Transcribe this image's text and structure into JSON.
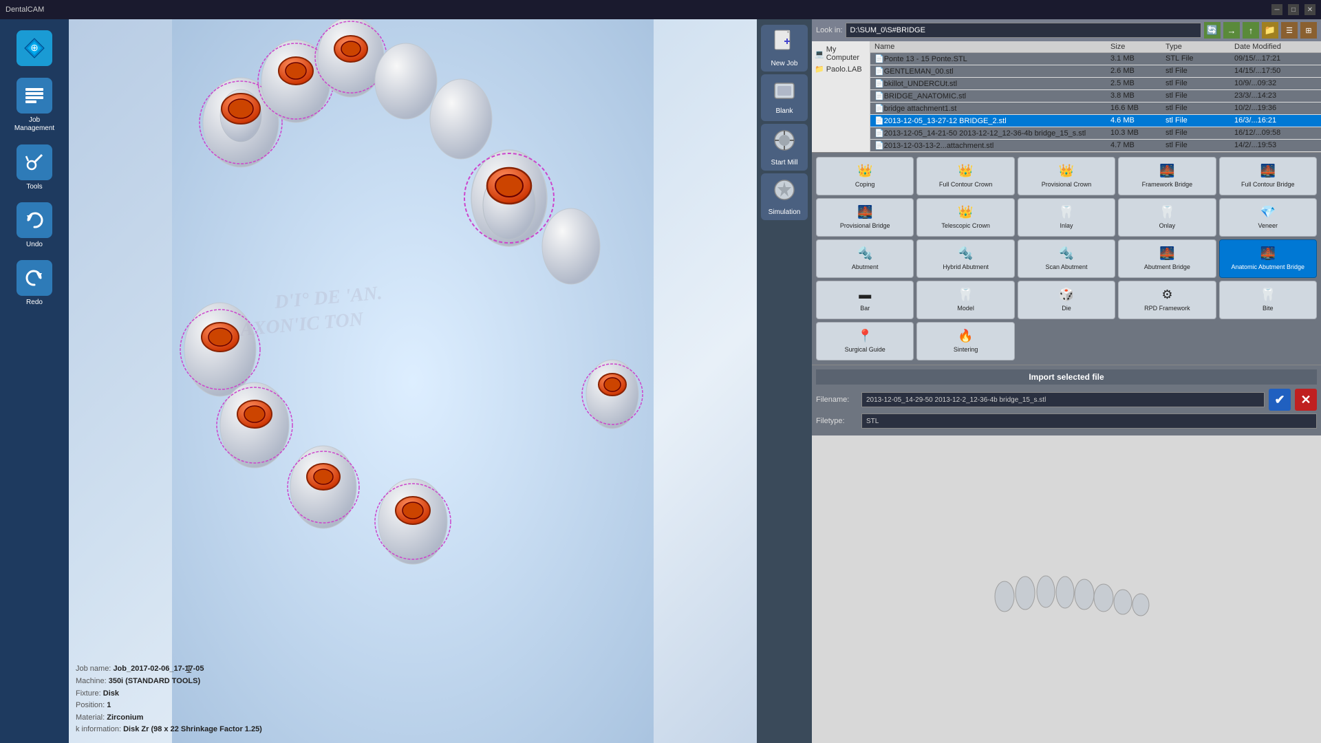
{
  "titleBar": {
    "title": "DentalCAM",
    "minimizeLabel": "─",
    "maximizeLabel": "□",
    "closeLabel": "✕"
  },
  "sidebar": {
    "items": [
      {
        "id": "navigation",
        "label": "Navigation",
        "icon": "⬡"
      },
      {
        "id": "job-management",
        "label": "Job Management",
        "icon": "⚙"
      },
      {
        "id": "tools",
        "label": "Tools",
        "icon": "🔧"
      },
      {
        "id": "undo",
        "label": "Undo",
        "icon": "↺"
      },
      {
        "id": "redo",
        "label": "Redo",
        "icon": "↻"
      }
    ]
  },
  "rightTools": {
    "items": [
      {
        "id": "new-job",
        "label": "New Job",
        "icon": "📄"
      },
      {
        "id": "blank",
        "label": "Blank",
        "icon": "⬜"
      },
      {
        "id": "start-mill",
        "label": "Start Mill",
        "icon": "⚙"
      },
      {
        "id": "simulation",
        "label": "Simulation",
        "icon": "⏱"
      }
    ]
  },
  "fileBrowser": {
    "pathLabel": "Look in:",
    "path": "D:\\SUM_0\\S#BRIDGE",
    "treeItems": [
      {
        "label": "My Computer",
        "icon": "💻"
      },
      {
        "label": "Paolo.LAB",
        "icon": "📁"
      }
    ],
    "columns": [
      "Name",
      "Size",
      "Type",
      "Date Modified"
    ],
    "files": [
      {
        "name": "Ponte 13 - 15 Ponte.STL",
        "size": "3.1 MB",
        "type": "STL File",
        "date": "09/15/...17:21",
        "selected": false
      },
      {
        "name": "GENTLEMAN_00.stl",
        "size": "2.6 MB",
        "type": "stl File",
        "date": "14/15/...17:50",
        "selected": false
      },
      {
        "name": "bkillot_UNDERCUt.stl",
        "size": "2.5 MB",
        "type": "stl File",
        "date": "10/9/...09:32",
        "selected": false
      },
      {
        "name": "BRIDGE_ANATOMIC.stl",
        "size": "3.8 MB",
        "type": "stl File",
        "date": "23/3/...14:23",
        "selected": false
      },
      {
        "name": "bridge attachment1.st",
        "size": "16.6 MB",
        "type": "stl File",
        "date": "10/2/...19:36",
        "selected": false
      },
      {
        "name": "2013-12-05_13-27-12 BRIDGE_2.stl",
        "size": "4.6 MB",
        "type": "stl File",
        "date": "16/3/...16:21",
        "selected": true
      },
      {
        "name": "2013-12-05_14-21-50 2013-12-12_12-36-4b bridge_15_s.stl",
        "size": "10.3 MB",
        "type": "stl File",
        "date": "16/12/...09:58",
        "selected": false
      },
      {
        "name": "2013-12-03-13-2...attachment.stl",
        "size": "4.7 MB",
        "type": "stl File",
        "date": "14/2/...19:53",
        "selected": false
      }
    ]
  },
  "typeGrid": {
    "rows": [
      [
        {
          "id": "coping",
          "label": "Coping",
          "icon": "👑",
          "active": false
        },
        {
          "id": "full-contour-crown",
          "label": "Full Contour Crown",
          "icon": "👑",
          "active": false
        },
        {
          "id": "provisional-crown",
          "label": "Provisional Crown",
          "icon": "👑",
          "active": false
        },
        {
          "id": "framework-bridge",
          "label": "Framework Bridge",
          "icon": "🌉",
          "active": false
        },
        {
          "id": "full-contour-bridge",
          "label": "Full Contour Bridge",
          "icon": "🌉",
          "active": false
        }
      ],
      [
        {
          "id": "provisional-bridge",
          "label": "Provisional Bridge",
          "icon": "🌉",
          "active": false
        },
        {
          "id": "telescopic-crown",
          "label": "Telescopic Crown",
          "icon": "👑",
          "active": false
        },
        {
          "id": "inlay",
          "label": "Inlay",
          "icon": "🦷",
          "active": false
        },
        {
          "id": "onlay",
          "label": "Onlay",
          "icon": "🦷",
          "active": false
        },
        {
          "id": "veneer",
          "label": "Veneer",
          "icon": "💎",
          "active": false
        }
      ],
      [
        {
          "id": "abutment",
          "label": "Abutment",
          "icon": "🔩",
          "active": false
        },
        {
          "id": "hybrid-abutment",
          "label": "Hybrid Abutment",
          "icon": "🔩",
          "active": false
        },
        {
          "id": "scan-abutment",
          "label": "Scan Abutment",
          "icon": "🔩",
          "active": false
        },
        {
          "id": "abutment-bridge",
          "label": "Abutment Bridge",
          "icon": "🌉",
          "active": false
        },
        {
          "id": "anatomic-abutment-bridge",
          "label": "Anatomic Abutment Bridge",
          "icon": "🌉",
          "active": true
        }
      ],
      [
        {
          "id": "bar",
          "label": "Bar",
          "icon": "▬",
          "active": false
        },
        {
          "id": "model",
          "label": "Model",
          "icon": "🦷",
          "active": false
        },
        {
          "id": "die",
          "label": "Die",
          "icon": "🎲",
          "active": false
        },
        {
          "id": "rpd-framework",
          "label": "RPD Framework",
          "icon": "⚙",
          "active": false
        },
        {
          "id": "bite",
          "label": "Bite",
          "icon": "🦷",
          "active": false
        }
      ],
      [
        {
          "id": "surgical-guide",
          "label": "Surgical Guide",
          "icon": "📍",
          "active": false
        },
        {
          "id": "sintering",
          "label": "Sintering",
          "icon": "🔥",
          "active": false
        }
      ]
    ]
  },
  "importSection": {
    "title": "Import selected file",
    "filenamePlaceholder": "2013-12-05_14-29-50 2013-12-2_12-36-4b bridge_15_s.stl",
    "filetypePlaceholder": "STL",
    "filenameLabel": "Filename:",
    "filetypeLabel": "Filetype:",
    "confirmLabel": "✔",
    "cancelLabel": "✕"
  },
  "jobInfo": {
    "jobNameLabel": "Job name:",
    "jobNameValue": "Job_2017-02-06_17-17-05",
    "machineLabel": "Machine:",
    "machineValue": "350i (STANDARD TOOLS)",
    "fixtureLabel": "Fixture:",
    "fixtureValue": "Disk",
    "positionLabel": "Position:",
    "positionValue": "1",
    "materialLabel": "Material:",
    "materialValue": "Zirconium",
    "extraLabel": "k information:",
    "extraValue": "Disk Zr (98 x 22 Shrinkage Factor 1.25)"
  },
  "viewport": {
    "watermark": "D'I° DE 'AN. AXON'IC TON"
  }
}
